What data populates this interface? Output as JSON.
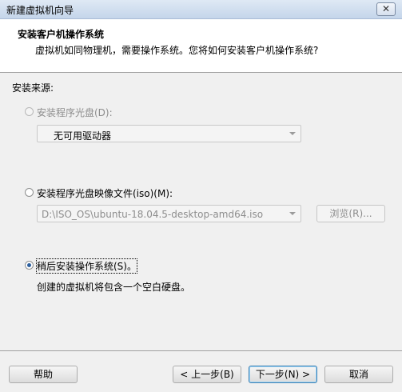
{
  "window": {
    "title": "新建虚拟机向导",
    "close_glyph": "✕"
  },
  "header": {
    "title": "安装客户机操作系统",
    "description": "虚拟机如同物理机，需要操作系统。您将如何安装客户机操作系统?"
  },
  "source": {
    "label": "安装来源:",
    "disc": {
      "label": "安装程序光盘(D):",
      "enabled": false,
      "selected_value": "无可用驱动器"
    },
    "iso": {
      "label": "安装程序光盘映像文件(iso)(M):",
      "selected": false,
      "path_value": "D:\\ISO_OS\\ubuntu-18.04.5-desktop-amd64.iso",
      "browse_label": "浏览(R)..."
    },
    "later": {
      "label": "稍后安装操作系统(S)。",
      "selected": true,
      "description": "创建的虚拟机将包含一个空白硬盘。"
    }
  },
  "footer": {
    "help_label": "帮助",
    "back_label": "< 上一步(B)",
    "next_label": "下一步(N) >",
    "cancel_label": "取消"
  },
  "colors": {
    "radio_dot": "#2c5f9e",
    "disabled_text": "#8d8d8d",
    "header_bg": "#ffffff",
    "body_bg": "#f0f0f0"
  }
}
